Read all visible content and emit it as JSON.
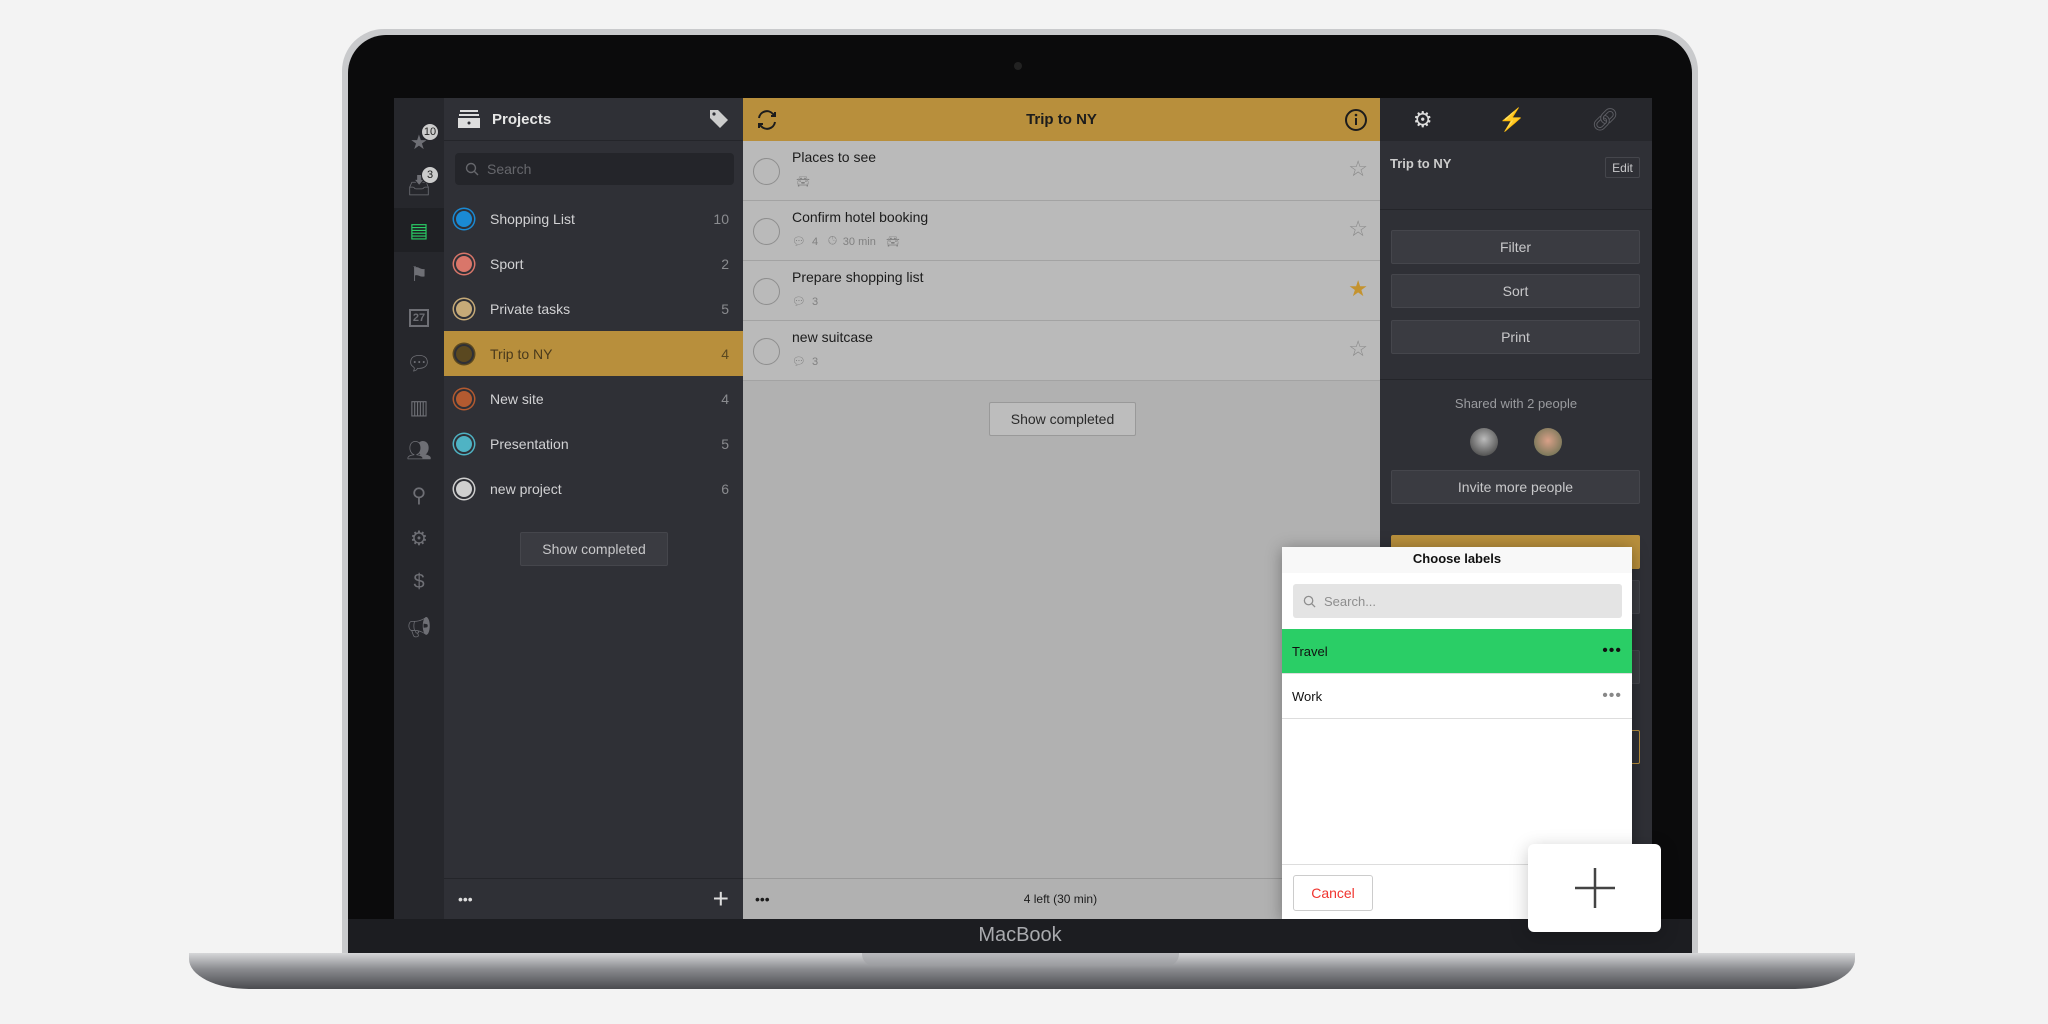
{
  "device": {
    "brand": "MacBook"
  },
  "sidebar_icons": [
    {
      "icon": "star-icon",
      "badge": "10"
    },
    {
      "icon": "inbox-icon",
      "badge": "3"
    },
    {
      "icon": "projects-icon",
      "selected": true
    },
    {
      "icon": "flag-icon"
    },
    {
      "icon": "calendar-icon",
      "text": "27"
    },
    {
      "icon": "chat-icon"
    },
    {
      "icon": "briefcase-icon"
    },
    {
      "icon": "people-icon"
    },
    {
      "icon": "search-icon"
    },
    {
      "icon": "gear-icon"
    },
    {
      "icon": "dollar-icon"
    },
    {
      "icon": "megaphone-icon"
    }
  ],
  "projects": {
    "title": "Projects",
    "search_placeholder": "Search",
    "items": [
      {
        "label": "Shopping List",
        "count": "10",
        "color": "#1a8ad4"
      },
      {
        "label": "Sport",
        "count": "2",
        "color": "#d9766a"
      },
      {
        "label": "Private tasks",
        "count": "5",
        "color": "#c6aa78"
      },
      {
        "label": "Trip to NY",
        "count": "4",
        "color": "#5a4820",
        "selected": true
      },
      {
        "label": "New site",
        "count": "4",
        "color": "#b35a30"
      },
      {
        "label": "Presentation",
        "count": "5",
        "color": "#4fb3c4"
      },
      {
        "label": "new project",
        "count": "6",
        "color": "#cfcfcf"
      }
    ],
    "show_completed": "Show completed",
    "more": "•••",
    "add": "+"
  },
  "tasks": {
    "title": "Trip to NY",
    "items": [
      {
        "title": "Places to see",
        "comments": "",
        "duration": "",
        "car": true,
        "starred": false
      },
      {
        "title": "Confirm hotel booking",
        "comments": "4",
        "duration": "30 min",
        "car": true,
        "starred": false
      },
      {
        "title": "Prepare shopping list",
        "comments": "3",
        "duration": "",
        "car": false,
        "starred": true
      },
      {
        "title": "new suitcase",
        "comments": "3",
        "duration": "",
        "car": false,
        "starred": false
      }
    ],
    "show_completed": "Show completed",
    "more": "•••",
    "footer": "4 left (30 min)"
  },
  "details": {
    "project_name": "Trip to NY",
    "edit": "Edit",
    "filter": "Filter",
    "sort": "Sort",
    "print": "Print",
    "shared": "Shared with 2 people",
    "invite": "Invite more people"
  },
  "labels_popup": {
    "title": "Choose labels",
    "search_placeholder": "Search...",
    "items": [
      {
        "label": "Travel",
        "selected": true
      },
      {
        "label": "Work",
        "selected": false
      }
    ],
    "more": "•••",
    "cancel": "Cancel"
  },
  "colors": {
    "accent": "#b88f3c",
    "selected_label": "#2ace66",
    "cancel": "#f0342f"
  }
}
